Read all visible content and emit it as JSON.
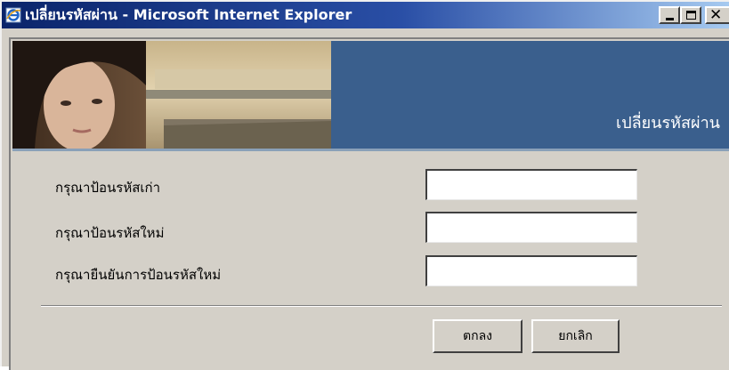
{
  "window": {
    "title": "เปลี่ยนรหัสผ่าน - Microsoft Internet Explorer"
  },
  "titlebar_icons": [
    "ie-icon",
    "minimize-icon",
    "maximize-icon",
    "close-icon"
  ],
  "banner": {
    "title": "เปลี่ยนรหัสผ่าน"
  },
  "form": {
    "old_password_label": "กรุณาป้อนรหัสเก่า",
    "new_password_label": "กรุณาป้อนรหัสใหม่",
    "confirm_password_label": "กรุณายืนยันการป้อนรหัสใหม่",
    "old_password_value": "",
    "new_password_value": "",
    "confirm_password_value": ""
  },
  "buttons": {
    "ok_label": "ตกลง",
    "cancel_label": "ยกเลิก"
  },
  "colors": {
    "titlebar_start": "#0a246a",
    "titlebar_end": "#a6caf0",
    "banner_blue": "#3a5f8d",
    "window_gray": "#d4d0c8"
  }
}
